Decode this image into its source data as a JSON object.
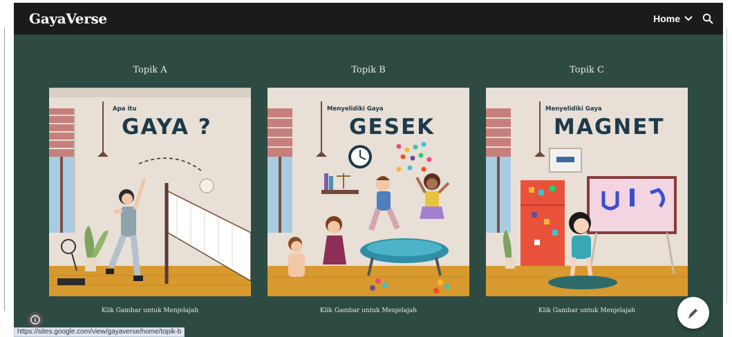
{
  "site": {
    "brand": "GayaVerse"
  },
  "nav": {
    "home_label": "Home"
  },
  "cards": [
    {
      "title": "Topik A",
      "image_small": "Apa itu",
      "image_big": "GAYA ?",
      "caption": "Klik Gambar untuk Menjelajah"
    },
    {
      "title": "Topik B",
      "image_small": "Menyelidiki Gaya",
      "image_big": "GESEK",
      "caption": "Klik Gambar untuk Menjelajah"
    },
    {
      "title": "Topik C",
      "image_small": "Menyelidiki Gaya",
      "image_big": "MAGNET",
      "caption": "Klik Gambar untuk Menjelajah"
    }
  ],
  "status_url": "https://sites.google.com/view/gayaverse/home/topik-b",
  "colors": {
    "background": "#2d4a43",
    "topbar": "#1b1b1b",
    "title_ink": "#1e3a4a",
    "floor": "#d89a2e",
    "wall": "#e8dfd6"
  }
}
